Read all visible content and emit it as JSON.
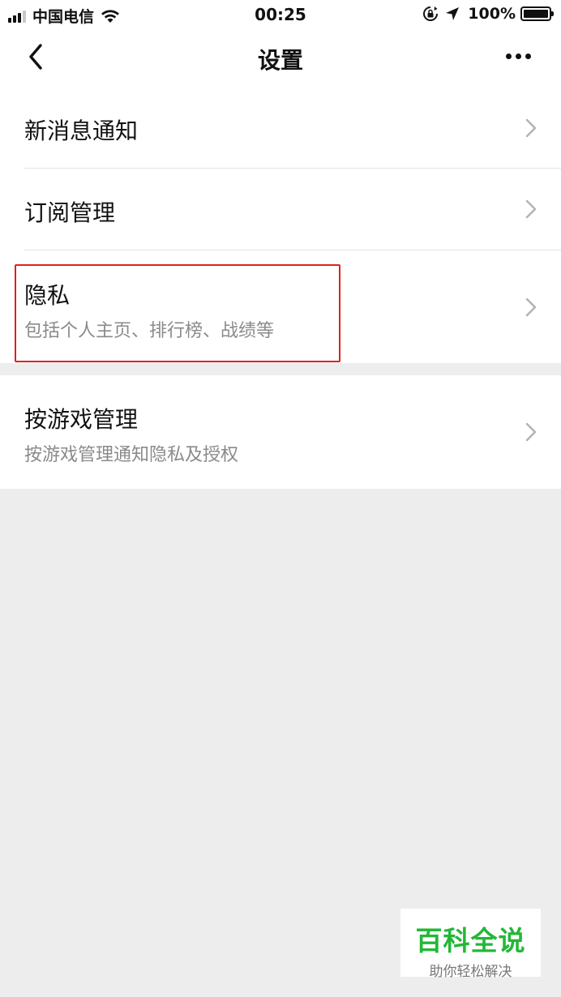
{
  "status_bar": {
    "carrier": "中国电信",
    "time": "00:25",
    "battery": "100%"
  },
  "nav": {
    "title": "设置"
  },
  "settings": {
    "new_message_notification": {
      "title": "新消息通知"
    },
    "subscription_management": {
      "title": "订阅管理"
    },
    "privacy": {
      "title": "隐私",
      "subtitle": "包括个人主页、排行榜、战绩等"
    },
    "game_management": {
      "title": "按游戏管理",
      "subtitle": "按游戏管理通知隐私及授权"
    }
  },
  "watermark": {
    "title": "百科全说",
    "subtitle": "助你轻松解决"
  },
  "colors": {
    "highlight_border": "#e02020",
    "watermark_green": "#22b836",
    "page_background": "#ededed"
  }
}
